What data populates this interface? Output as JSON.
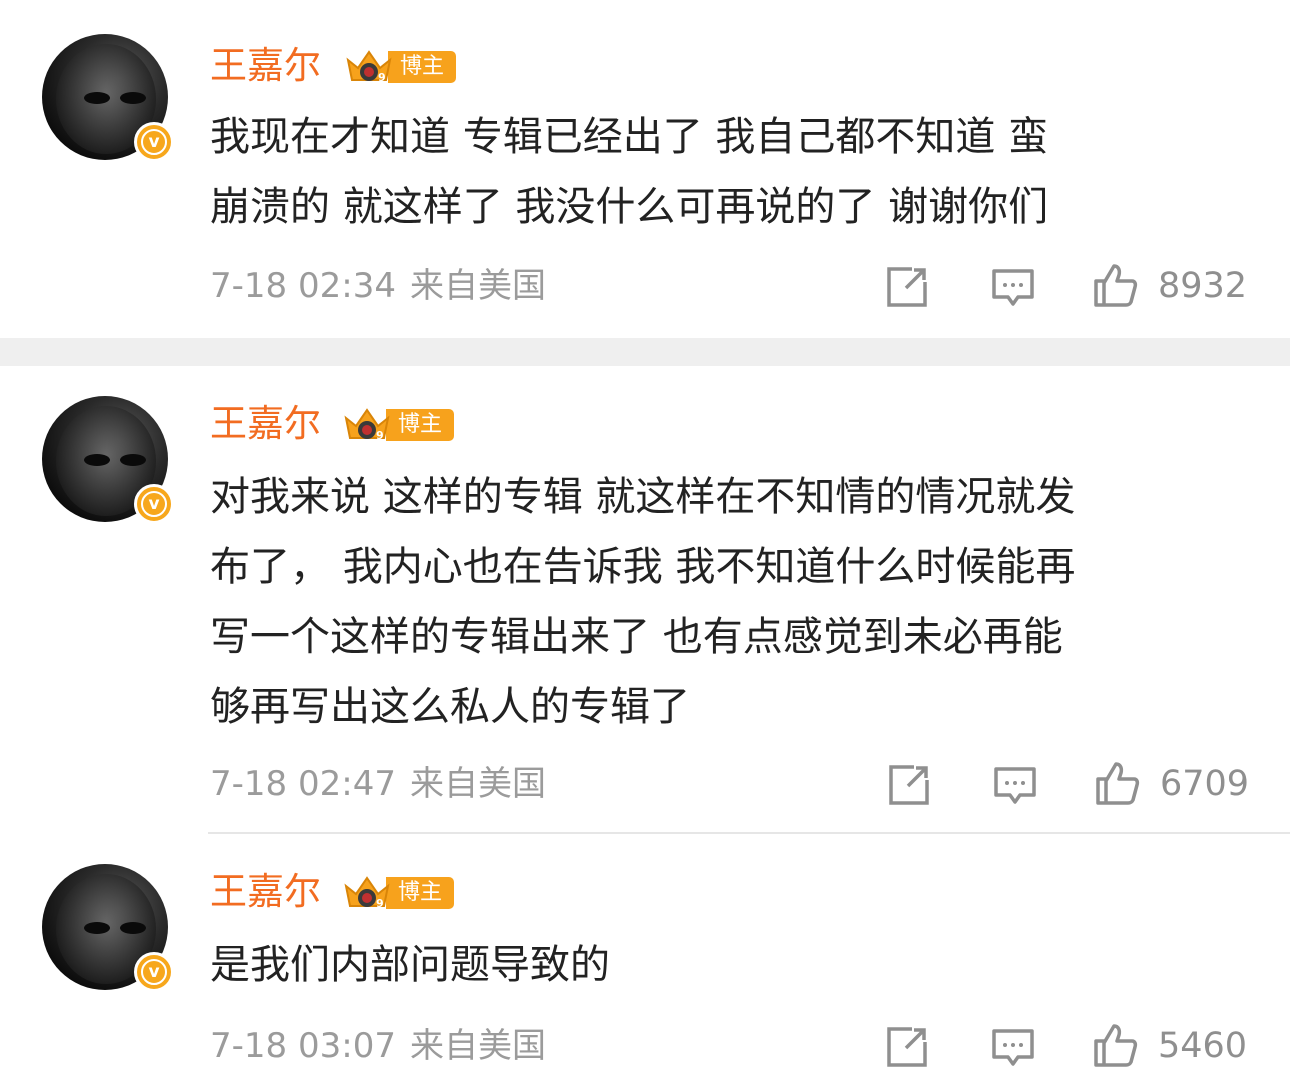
{
  "comments": [
    {
      "author": "王嘉尔",
      "badge": "博主",
      "text": "我现在才知道 专辑已经出了 我自己都不知道 蛮\n崩溃的  就这样了 我没什么可再说的了  谢谢你们",
      "date": "7-18 02:34",
      "source": "来自美国",
      "likes": "8932"
    },
    {
      "author": "王嘉尔",
      "badge": "博主",
      "text": "对我来说 这样的专辑 就这样在不知情的情况就发\n布了，  我内心也在告诉我 我不知道什么时候能再\n写一个这样的专辑出来了 也有点感觉到未必再能\n够再写出这么私人的专辑了",
      "date": "7-18 02:47",
      "source": "来自美国",
      "likes": "6709"
    },
    {
      "author": "王嘉尔",
      "badge": "博主",
      "text": "是我们内部问题导致的",
      "date": "7-18 03:07",
      "source": "来自美国",
      "likes": "5460"
    }
  ],
  "verified_badge": "v",
  "icons": {
    "share": "share-icon",
    "comment": "comment-icon",
    "like": "like-icon",
    "crown": "crown-icon"
  },
  "colors": {
    "name": "#f26c21",
    "badge": "#f7a21c",
    "text": "#222222",
    "meta": "#9b9b9b"
  }
}
